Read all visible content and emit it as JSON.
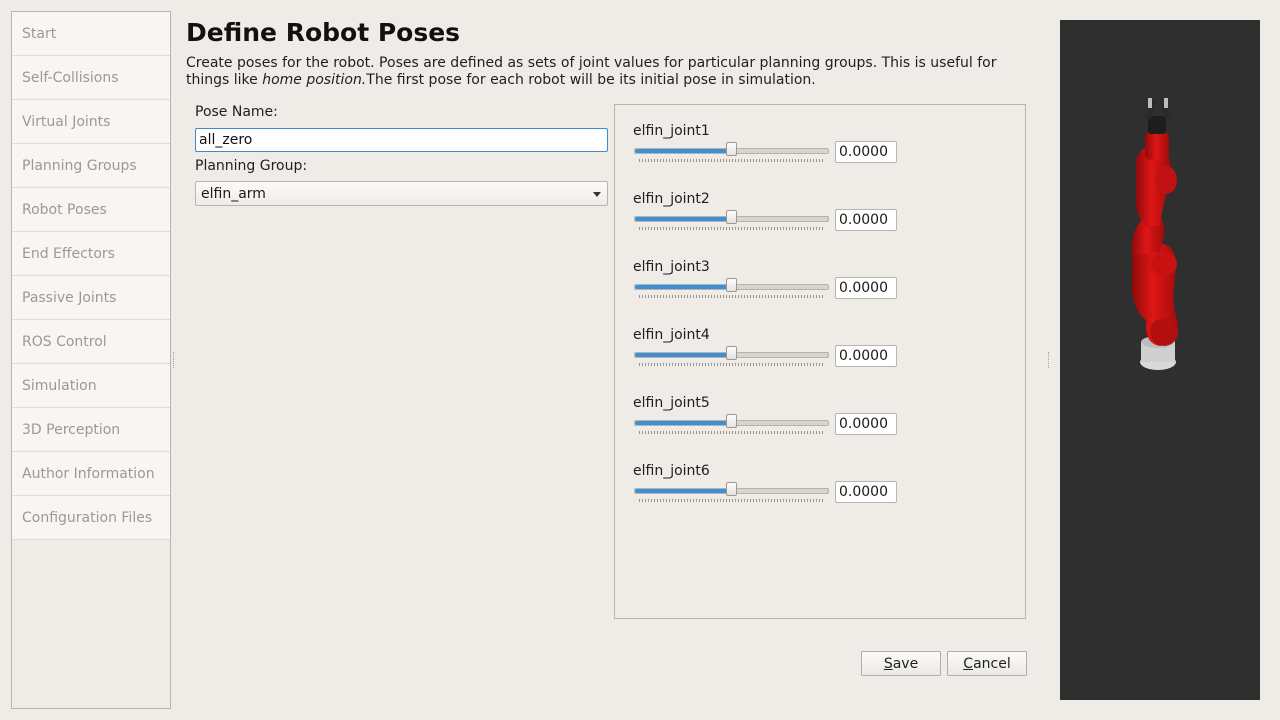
{
  "sidebar": {
    "items": [
      {
        "label": "Start"
      },
      {
        "label": "Self-Collisions"
      },
      {
        "label": "Virtual Joints"
      },
      {
        "label": "Planning Groups"
      },
      {
        "label": "Robot Poses"
      },
      {
        "label": "End Effectors"
      },
      {
        "label": "Passive Joints"
      },
      {
        "label": "ROS Control"
      },
      {
        "label": "Simulation"
      },
      {
        "label": "3D Perception"
      },
      {
        "label": "Author Information"
      },
      {
        "label": "Configuration Files"
      }
    ]
  },
  "page": {
    "title": "Define Robot Poses",
    "description_part1": "Create poses for the robot. Poses are defined as sets of joint values for particular planning groups. This is useful for things like ",
    "description_italic": "home position.",
    "description_part2": "The first pose for each robot will be its initial pose in simulation."
  },
  "form": {
    "pose_name_label": "Pose Name:",
    "pose_name_value": "all_zero",
    "planning_group_label": "Planning Group:",
    "planning_group_value": "elfin_arm"
  },
  "joints": [
    {
      "name": "elfin_joint1",
      "value": "0.0000",
      "slider_fraction": 0.5
    },
    {
      "name": "elfin_joint2",
      "value": "0.0000",
      "slider_fraction": 0.5
    },
    {
      "name": "elfin_joint3",
      "value": "0.0000",
      "slider_fraction": 0.5
    },
    {
      "name": "elfin_joint4",
      "value": "0.0000",
      "slider_fraction": 0.5
    },
    {
      "name": "elfin_joint5",
      "value": "0.0000",
      "slider_fraction": 0.5
    },
    {
      "name": "elfin_joint6",
      "value": "0.0000",
      "slider_fraction": 0.5
    }
  ],
  "buttons": {
    "save_mnemonic": "S",
    "save_rest": "ave",
    "cancel_mnemonic": "C",
    "cancel_rest": "ancel"
  },
  "colors": {
    "accent": "#3f8fd8",
    "robot_red": "#d01010",
    "viewer_background": "#2f2f2f"
  }
}
